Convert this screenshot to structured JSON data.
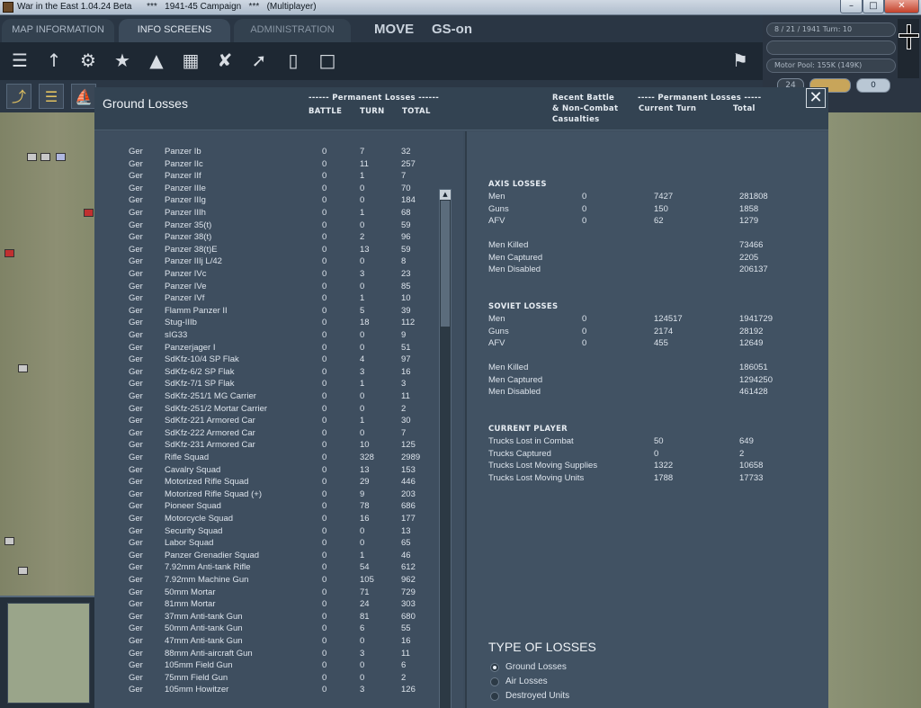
{
  "window": {
    "title": "War in the East 1.04.24 Beta      ***   1941-45 Campaign   ***   (Multiplayer)",
    "minimize": "–",
    "maximize": "□",
    "close": "✕"
  },
  "header": {
    "tabs": [
      "MAP INFORMATION",
      "INFO SCREENS",
      "ADMINISTRATION"
    ],
    "mode": "MOVE",
    "gs": "GS-on"
  },
  "status": {
    "date_turn": "8 / 21 / 1941      Turn: 10",
    "motor_pool": "Motor Pool: 155K (149K)",
    "field3": "24",
    "pill": "0"
  },
  "toolbar_icons": [
    "stack-icon",
    "units-icon",
    "gear-icon",
    "star-icon",
    "hq-icon",
    "grid-icon",
    "aircraft-icon",
    "rocket-icon",
    "fuel-icon",
    "document-icon",
    "flag-icon"
  ],
  "dialog": {
    "title": "Ground Losses",
    "perm_header_left": "------ Permanent Losses ------",
    "col_battle": "BATTLE",
    "col_turn": "TURN",
    "col_total": "TOTAL",
    "recent_header": [
      "Recent Battle",
      "& Non-Combat",
      "Casualties"
    ],
    "perm_header_right": "----- Permanent Losses -----",
    "col_current_turn": "Current Turn",
    "col_total_right": "Total",
    "close": "✕"
  },
  "losses": [
    {
      "nat": "Ger",
      "name": "Panzer Ib",
      "battle": "0",
      "turn": "7",
      "total": "32"
    },
    {
      "nat": "Ger",
      "name": "Panzer IIc",
      "battle": "0",
      "turn": "11",
      "total": "257"
    },
    {
      "nat": "Ger",
      "name": "Panzer IIf",
      "battle": "0",
      "turn": "1",
      "total": "7"
    },
    {
      "nat": "Ger",
      "name": "Panzer IIIe",
      "battle": "0",
      "turn": "0",
      "total": "70"
    },
    {
      "nat": "Ger",
      "name": "Panzer IIIg",
      "battle": "0",
      "turn": "0",
      "total": "184"
    },
    {
      "nat": "Ger",
      "name": "Panzer IIIh",
      "battle": "0",
      "turn": "1",
      "total": "68"
    },
    {
      "nat": "Ger",
      "name": "Panzer 35(t)",
      "battle": "0",
      "turn": "0",
      "total": "59"
    },
    {
      "nat": "Ger",
      "name": "Panzer 38(t)",
      "battle": "0",
      "turn": "2",
      "total": "96"
    },
    {
      "nat": "Ger",
      "name": "Panzer 38(t)E",
      "battle": "0",
      "turn": "13",
      "total": "59"
    },
    {
      "nat": "Ger",
      "name": "Panzer IIIj L/42",
      "battle": "0",
      "turn": "0",
      "total": "8"
    },
    {
      "nat": "Ger",
      "name": "Panzer IVc",
      "battle": "0",
      "turn": "3",
      "total": "23"
    },
    {
      "nat": "Ger",
      "name": "Panzer IVe",
      "battle": "0",
      "turn": "0",
      "total": "85"
    },
    {
      "nat": "Ger",
      "name": "Panzer IVf",
      "battle": "0",
      "turn": "1",
      "total": "10"
    },
    {
      "nat": "Ger",
      "name": "Flamm Panzer II",
      "battle": "0",
      "turn": "5",
      "total": "39"
    },
    {
      "nat": "Ger",
      "name": "Stug-IIIb",
      "battle": "0",
      "turn": "18",
      "total": "112"
    },
    {
      "nat": "Ger",
      "name": "sIG33",
      "battle": "0",
      "turn": "0",
      "total": "9"
    },
    {
      "nat": "Ger",
      "name": "Panzerjager I",
      "battle": "0",
      "turn": "0",
      "total": "51"
    },
    {
      "nat": "Ger",
      "name": "SdKfz-10/4 SP Flak",
      "battle": "0",
      "turn": "4",
      "total": "97"
    },
    {
      "nat": "Ger",
      "name": "SdKfz-6/2 SP Flak",
      "battle": "0",
      "turn": "3",
      "total": "16"
    },
    {
      "nat": "Ger",
      "name": "SdKfz-7/1 SP Flak",
      "battle": "0",
      "turn": "1",
      "total": "3"
    },
    {
      "nat": "Ger",
      "name": "SdKfz-251/1 MG Carrier",
      "battle": "0",
      "turn": "0",
      "total": "11"
    },
    {
      "nat": "Ger",
      "name": "SdKfz-251/2 Mortar Carrier",
      "battle": "0",
      "turn": "0",
      "total": "2"
    },
    {
      "nat": "Ger",
      "name": "SdKfz-221 Armored Car",
      "battle": "0",
      "turn": "1",
      "total": "30"
    },
    {
      "nat": "Ger",
      "name": "SdKfz-222 Armored Car",
      "battle": "0",
      "turn": "0",
      "total": "7"
    },
    {
      "nat": "Ger",
      "name": "SdKfz-231 Armored Car",
      "battle": "0",
      "turn": "10",
      "total": "125"
    },
    {
      "nat": "Ger",
      "name": "Rifle Squad",
      "battle": "0",
      "turn": "328",
      "total": "2989"
    },
    {
      "nat": "Ger",
      "name": "Cavalry Squad",
      "battle": "0",
      "turn": "13",
      "total": "153"
    },
    {
      "nat": "Ger",
      "name": "Motorized Rifle Squad",
      "battle": "0",
      "turn": "29",
      "total": "446"
    },
    {
      "nat": "Ger",
      "name": "Motorized Rifle Squad (+)",
      "battle": "0",
      "turn": "9",
      "total": "203"
    },
    {
      "nat": "Ger",
      "name": "Pioneer Squad",
      "battle": "0",
      "turn": "78",
      "total": "686"
    },
    {
      "nat": "Ger",
      "name": "Motorcycle Squad",
      "battle": "0",
      "turn": "16",
      "total": "177"
    },
    {
      "nat": "Ger",
      "name": "Security Squad",
      "battle": "0",
      "turn": "0",
      "total": "13"
    },
    {
      "nat": "Ger",
      "name": "Labor Squad",
      "battle": "0",
      "turn": "0",
      "total": "65"
    },
    {
      "nat": "Ger",
      "name": "Panzer Grenadier Squad",
      "battle": "0",
      "turn": "1",
      "total": "46"
    },
    {
      "nat": "Ger",
      "name": "7.92mm Anti-tank Rifle",
      "battle": "0",
      "turn": "54",
      "total": "612"
    },
    {
      "nat": "Ger",
      "name": "7.92mm Machine Gun",
      "battle": "0",
      "turn": "105",
      "total": "962"
    },
    {
      "nat": "Ger",
      "name": "50mm Mortar",
      "battle": "0",
      "turn": "71",
      "total": "729"
    },
    {
      "nat": "Ger",
      "name": "81mm Mortar",
      "battle": "0",
      "turn": "24",
      "total": "303"
    },
    {
      "nat": "Ger",
      "name": "37mm Anti-tank Gun",
      "battle": "0",
      "turn": "81",
      "total": "680"
    },
    {
      "nat": "Ger",
      "name": "50mm Anti-tank Gun",
      "battle": "0",
      "turn": "6",
      "total": "55"
    },
    {
      "nat": "Ger",
      "name": "47mm Anti-tank Gun",
      "battle": "0",
      "turn": "0",
      "total": "16"
    },
    {
      "nat": "Ger",
      "name": "88mm Anti-aircraft Gun",
      "battle": "0",
      "turn": "3",
      "total": "11"
    },
    {
      "nat": "Ger",
      "name": "105mm Field Gun",
      "battle": "0",
      "turn": "0",
      "total": "6"
    },
    {
      "nat": "Ger",
      "name": "75mm Field Gun",
      "battle": "0",
      "turn": "0",
      "total": "2"
    },
    {
      "nat": "Ger",
      "name": "105mm Howitzer",
      "battle": "0",
      "turn": "3",
      "total": "126"
    }
  ],
  "summary": {
    "axis_title": "AXIS LOSSES",
    "axis": [
      {
        "label": "Men",
        "recent": "0",
        "turn": "7427",
        "total": "281808"
      },
      {
        "label": "Guns",
        "recent": "0",
        "turn": "150",
        "total": "1858"
      },
      {
        "label": "AFV",
        "recent": "0",
        "turn": "62",
        "total": "1279"
      }
    ],
    "axis_men": [
      {
        "label": "Men Killed",
        "total": "73466"
      },
      {
        "label": "Men Captured",
        "total": "2205"
      },
      {
        "label": "Men Disabled",
        "total": "206137"
      }
    ],
    "soviet_title": "SOVIET LOSSES",
    "soviet": [
      {
        "label": "Men",
        "recent": "0",
        "turn": "124517",
        "total": "1941729"
      },
      {
        "label": "Guns",
        "recent": "0",
        "turn": "2174",
        "total": "28192"
      },
      {
        "label": "AFV",
        "recent": "0",
        "turn": "455",
        "total": "12649"
      }
    ],
    "soviet_men": [
      {
        "label": "Men Killed",
        "total": "186051"
      },
      {
        "label": "Men Captured",
        "total": "1294250"
      },
      {
        "label": "Men Disabled",
        "total": "461428"
      }
    ],
    "player_title": "CURRENT PLAYER",
    "player": [
      {
        "label": "Trucks Lost in Combat",
        "turn": "50",
        "total": "649"
      },
      {
        "label": "Trucks Captured",
        "turn": "0",
        "total": "2"
      },
      {
        "label": "Trucks Lost Moving Supplies",
        "turn": "1322",
        "total": "10658"
      },
      {
        "label": "Trucks Lost Moving Units",
        "turn": "1788",
        "total": "17733"
      }
    ]
  },
  "types": {
    "title": "TYPE OF LOSSES",
    "options": [
      {
        "label": "Ground Losses",
        "selected": true
      },
      {
        "label": "Air Losses",
        "selected": false
      },
      {
        "label": "Destroyed Units",
        "selected": false
      }
    ]
  }
}
